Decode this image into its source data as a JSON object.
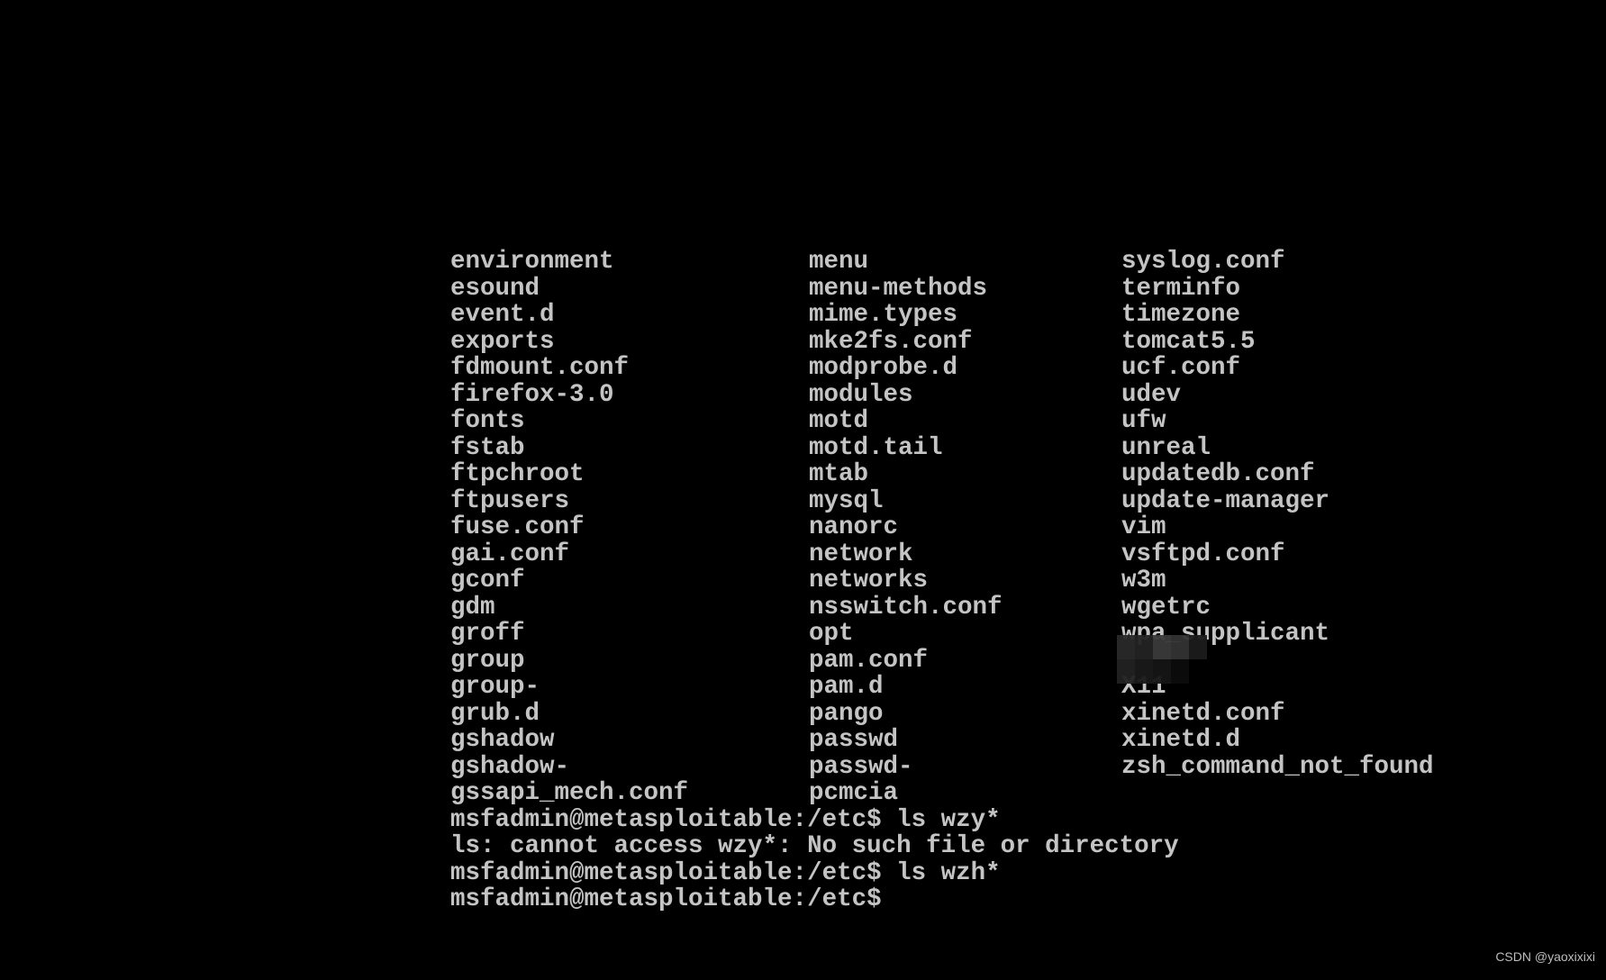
{
  "terminal": {
    "columns": [
      [
        "environment",
        "esound",
        "event.d",
        "exports",
        "fdmount.conf",
        "firefox-3.0",
        "fonts",
        "fstab",
        "ftpchroot",
        "ftpusers",
        "fuse.conf",
        "gai.conf",
        "gconf",
        "gdm",
        "groff",
        "group",
        "group-",
        "grub.d",
        "gshadow",
        "gshadow-",
        "gssapi_mech.conf"
      ],
      [
        "menu",
        "menu-methods",
        "mime.types",
        "mke2fs.conf",
        "modprobe.d",
        "modules",
        "motd",
        "motd.tail",
        "mtab",
        "mysql",
        "nanorc",
        "network",
        "networks",
        "nsswitch.conf",
        "opt",
        "pam.conf",
        "pam.d",
        "pango",
        "passwd",
        "passwd-",
        "pcmcia"
      ],
      [
        "syslog.conf",
        "terminfo",
        "timezone",
        "tomcat5.5",
        "ucf.conf",
        "udev",
        "ufw",
        "unreal",
        "updatedb.conf",
        "update-manager",
        "vim",
        "vsftpd.conf",
        "w3m",
        "wgetrc",
        "wpa_supplicant",
        "",
        "X11",
        "xinetd.conf",
        "xinetd.d",
        "zsh_command_not_found",
        ""
      ]
    ],
    "output_lines": [
      "msfadmin@metasploitable:/etc$ ls wzy*",
      "ls: cannot access wzy*: No such file or directory",
      "msfadmin@metasploitable:/etc$ ls wzh*",
      "msfadmin@metasploitable:/etc$ "
    ],
    "text_color": "#c4c4c4",
    "background": "#000000"
  },
  "watermark": "CSDN @yaoxixixi"
}
